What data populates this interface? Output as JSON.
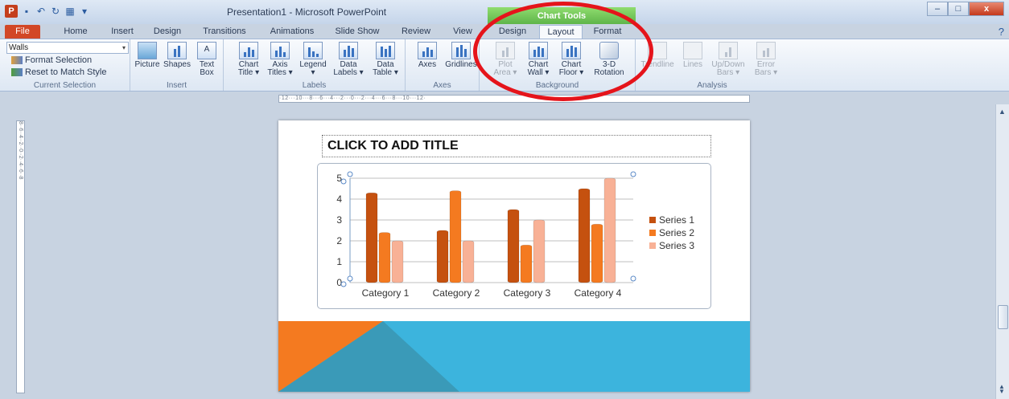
{
  "window": {
    "title": "Presentation1 - Microsoft PowerPoint",
    "contextual_tab": "Chart Tools",
    "minimize": "–",
    "maximize": "□",
    "close": "x",
    "help": "?"
  },
  "tabs": [
    "File",
    "Home",
    "Insert",
    "Design",
    "Transitions",
    "Animations",
    "Slide Show",
    "Review",
    "View",
    "Design",
    "Layout",
    "Format"
  ],
  "active_tab": "Layout",
  "ribbon": {
    "current_selection": {
      "dropdown_value": "Walls",
      "format_selection": "Format Selection",
      "reset": "Reset to Match Style",
      "label": "Current Selection"
    },
    "insert": {
      "picture": "Picture",
      "shapes": "Shapes",
      "text_box_1": "Text",
      "text_box_2": "Box",
      "label": "Insert"
    },
    "labels": {
      "chart_title_1": "Chart",
      "chart_title_2": "Title ▾",
      "axis_titles_1": "Axis",
      "axis_titles_2": "Titles ▾",
      "legend_1": "Legend",
      "legend_2": "▾",
      "data_labels_1": "Data",
      "data_labels_2": "Labels ▾",
      "data_table_1": "Data",
      "data_table_2": "Table ▾",
      "label": "Labels"
    },
    "axes": {
      "axes": "Axes",
      "gridlines": "Gridlines",
      "label": "Axes"
    },
    "background": {
      "plot_area_1": "Plot",
      "plot_area_2": "Area ▾",
      "chart_wall_1": "Chart",
      "chart_wall_2": "Wall ▾",
      "chart_floor_1": "Chart",
      "chart_floor_2": "Floor ▾",
      "rotation_1": "3-D",
      "rotation_2": "Rotation",
      "label": "Background"
    },
    "analysis": {
      "trendline": "Trendline",
      "lines": "Lines",
      "updown_1": "Up/Down",
      "updown_2": "Bars ▾",
      "error_1": "Error",
      "error_2": "Bars ▾",
      "label": "Analysis"
    }
  },
  "ruler": {
    "horizontal": "·12···10···8···6···4···2···0···2···4···6···8···10···12·",
    "vertical": "8··6··4··2··0··2··4··6··8"
  },
  "slide": {
    "title_placeholder": "CLICK TO ADD TITLE",
    "band_colors": [
      "#f47a20",
      "#3a9ab8",
      "#3cb4dd"
    ]
  },
  "chart_data": {
    "type": "bar",
    "categories": [
      "Category 1",
      "Category 2",
      "Category 3",
      "Category 4"
    ],
    "series": [
      {
        "name": "Series 1",
        "values": [
          4.3,
          2.5,
          3.5,
          4.5
        ],
        "color": "#c5510f"
      },
      {
        "name": "Series 2",
        "values": [
          2.4,
          4.4,
          1.8,
          2.8
        ],
        "color": "#f47a20"
      },
      {
        "name": "Series 3",
        "values": [
          2.0,
          2.0,
          3.0,
          5.0
        ],
        "color": "#f8b196"
      }
    ],
    "ylim": [
      0,
      5
    ],
    "yticks": [
      "0",
      "1",
      "2",
      "3",
      "4",
      "5"
    ],
    "grid": true,
    "legend": "right"
  }
}
